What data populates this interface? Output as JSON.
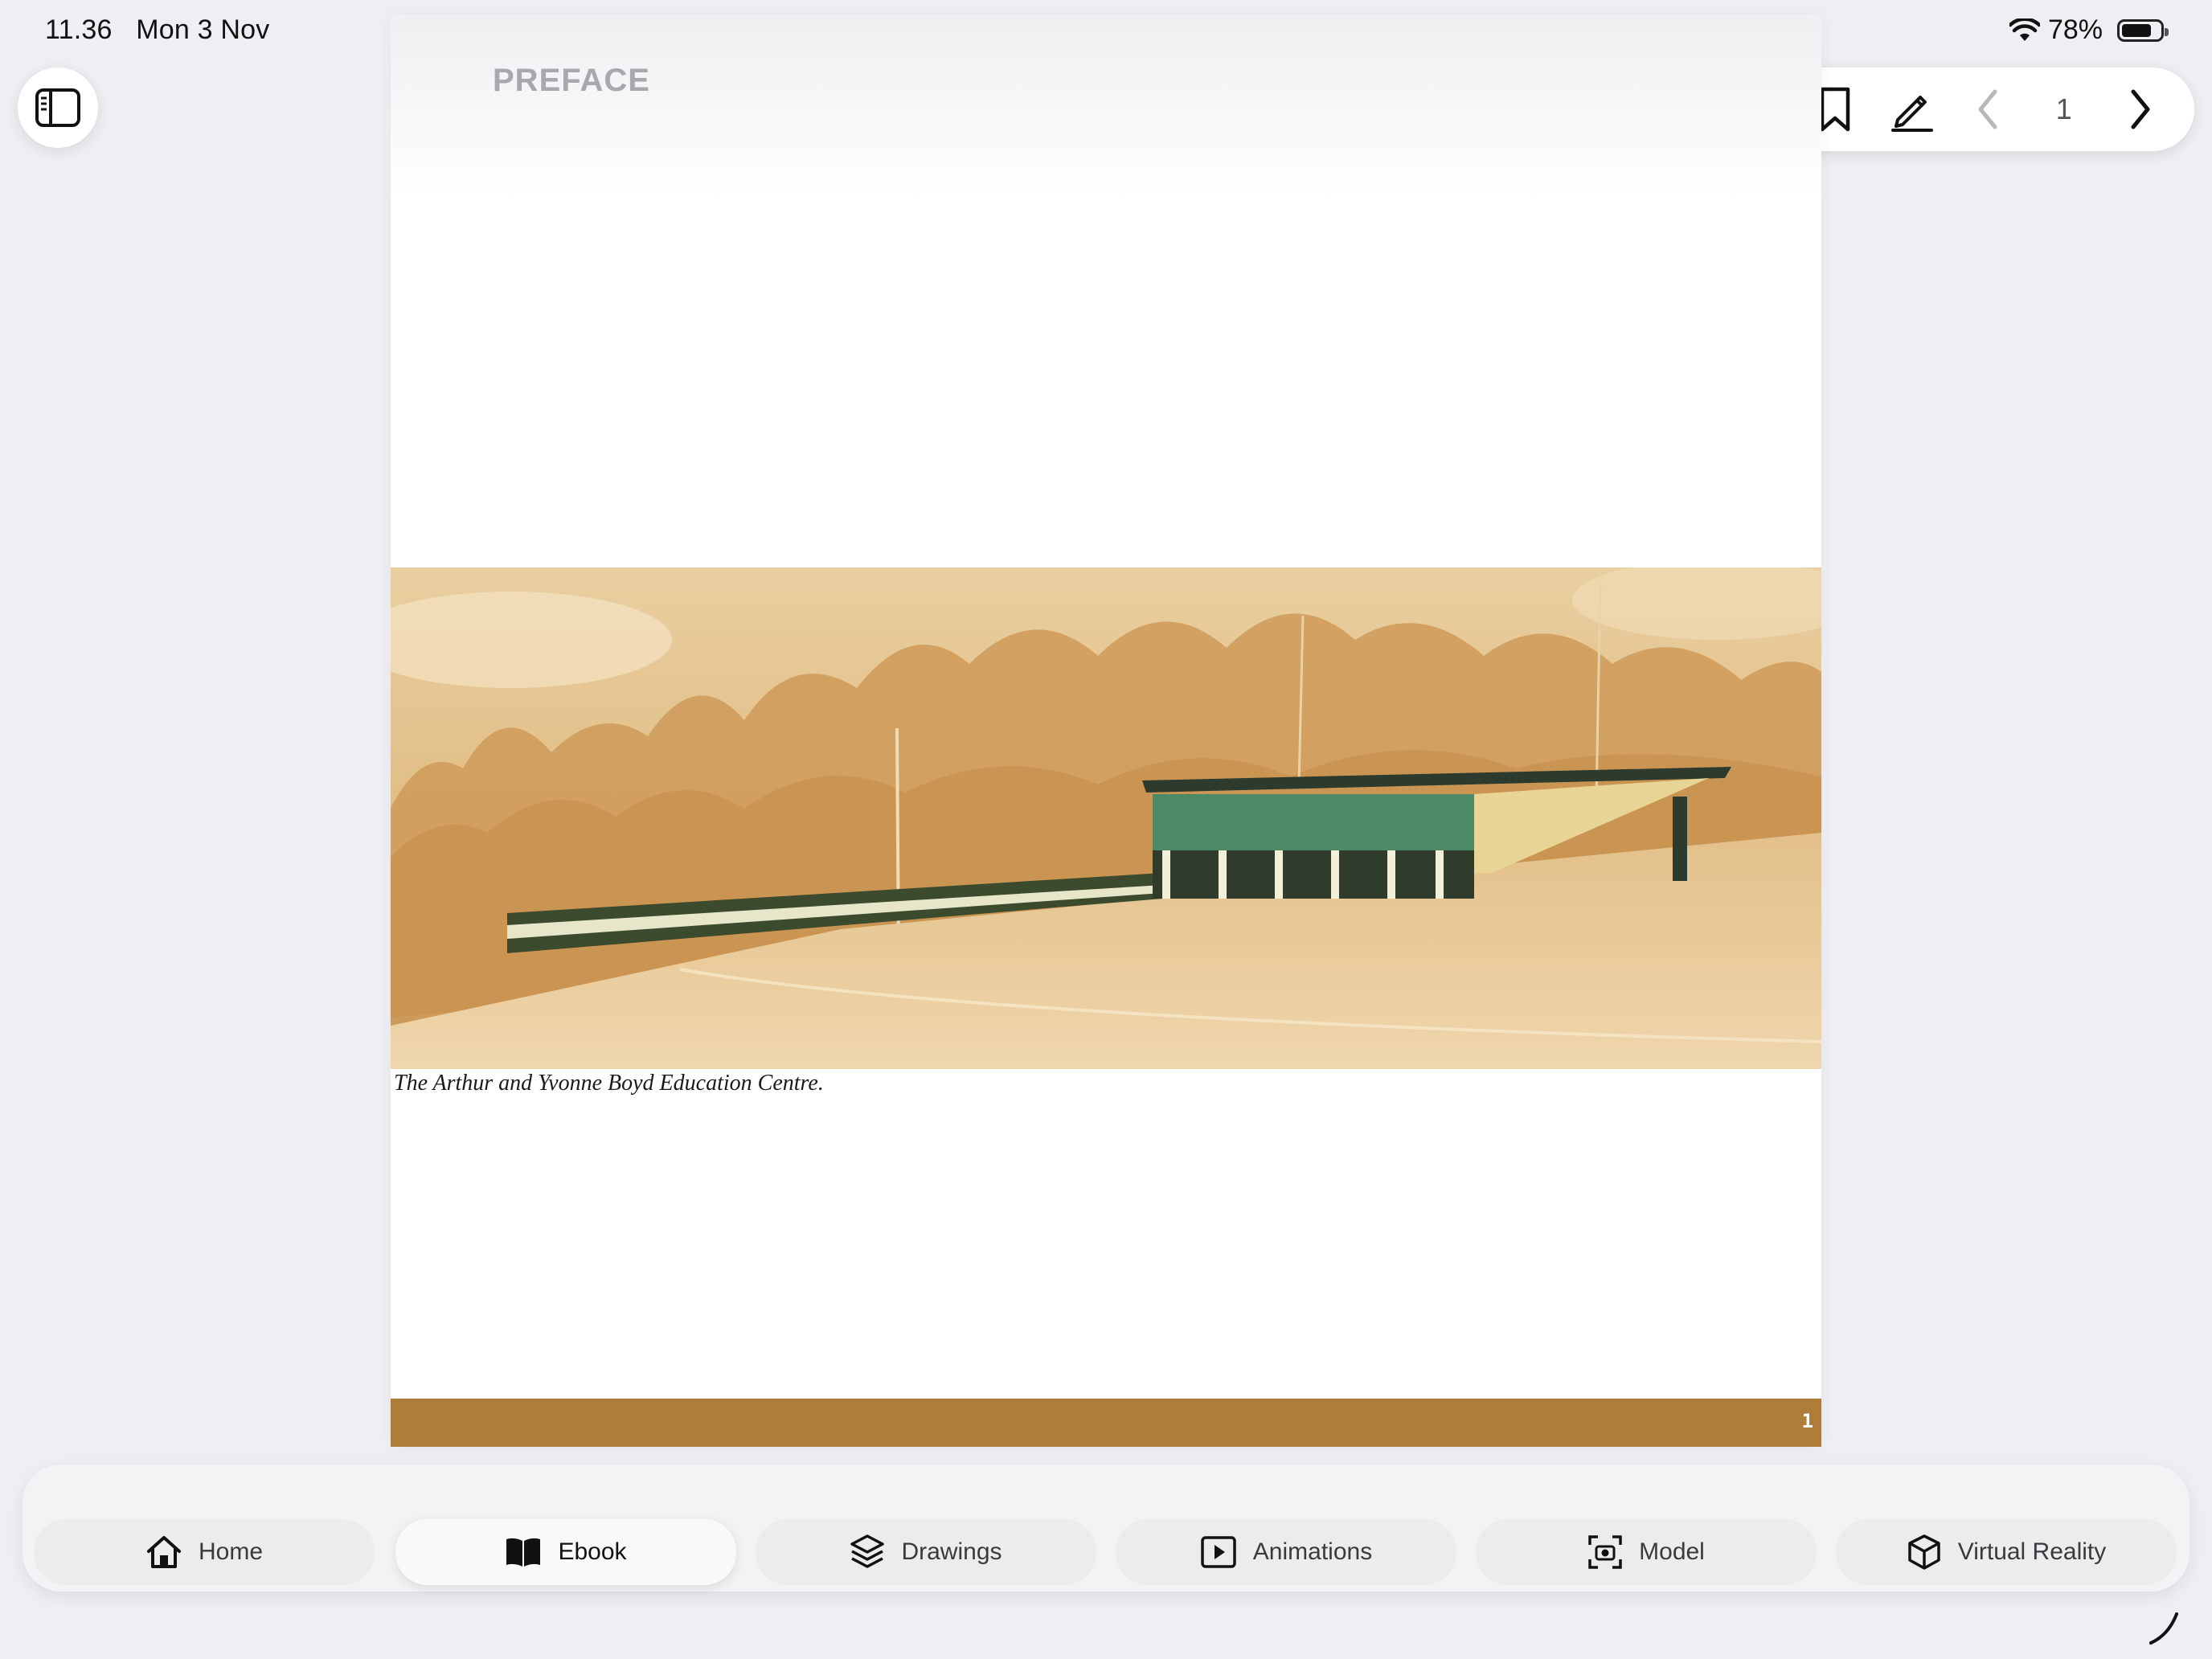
{
  "status_bar": {
    "time": "11.36",
    "date": "Mon 3 Nov",
    "battery": "78%",
    "battery_level": 0.78
  },
  "toolbar": {
    "current_page": "1",
    "icons": [
      "bookmark-icon",
      "pencil-icon",
      "chevron-left-icon",
      "chevron-right-icon"
    ]
  },
  "page": {
    "heading": "PREFACE",
    "caption": "The Arthur and Yvonne Boyd Education Centre.",
    "footer_page_number": "1",
    "accent_color": "#b07c3a"
  },
  "tabs": [
    {
      "label": "Home",
      "icon": "house-icon",
      "active": false
    },
    {
      "label": "Ebook",
      "icon": "book-icon",
      "active": true
    },
    {
      "label": "Drawings",
      "icon": "layers-icon",
      "active": false
    },
    {
      "label": "Animations",
      "icon": "play-icon",
      "active": false
    },
    {
      "label": "Model",
      "icon": "camera-scan-icon",
      "active": false
    },
    {
      "label": "Virtual Reality",
      "icon": "cube-icon",
      "active": false
    }
  ]
}
